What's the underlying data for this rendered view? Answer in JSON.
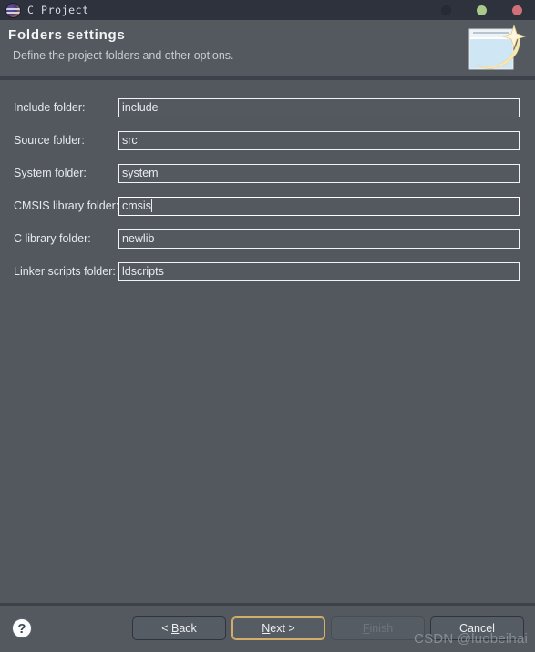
{
  "window": {
    "title": "C Project",
    "app_icon": "eclipse-c-project-icon",
    "controls": {
      "minimize": "minimize-dot",
      "maximize": "maximize-dot",
      "close": "close-dot"
    },
    "colors": {
      "titlebar_bg": "#2e323c",
      "dialog_bg": "#52585e",
      "separator": "#3c414a",
      "text": "#e6e9ed",
      "focus_ring": "#d3ad6a",
      "maximize_dot": "#a9c98c",
      "close_dot": "#d2707a",
      "minimize_dot": "#262a33"
    }
  },
  "header": {
    "title": "Folders settings",
    "subtitle": "Define the project folders and other options.",
    "banner_icon": "wizard-banner-icon"
  },
  "form": {
    "fields": [
      {
        "label": "Include folder:",
        "value": "include",
        "name": "include-folder",
        "focused": false
      },
      {
        "label": "Source folder:",
        "value": "src",
        "name": "source-folder",
        "focused": false
      },
      {
        "label": "System folder:",
        "value": "system",
        "name": "system-folder",
        "focused": false
      },
      {
        "label": "CMSIS library folder:",
        "value": "cmsis",
        "name": "cmsis-library-folder",
        "focused": true
      },
      {
        "label": "C library folder:",
        "value": "newlib",
        "name": "c-library-folder",
        "focused": false
      },
      {
        "label": "Linker scripts folder:",
        "value": "ldscripts",
        "name": "linker-scripts-folder",
        "focused": false
      }
    ]
  },
  "footer": {
    "help_glyph": "?",
    "buttons": [
      {
        "label": "< Back",
        "mnemonic": "B",
        "pre": "< ",
        "post": "ack",
        "state": "normal"
      },
      {
        "label": "Next >",
        "mnemonic": "N",
        "pre": "",
        "post": "ext >",
        "state": "focused"
      },
      {
        "label": "Finish",
        "mnemonic": "F",
        "pre": "",
        "post": "inish",
        "state": "disabled"
      },
      {
        "label": "Cancel",
        "mnemonic": "",
        "pre": "Cancel",
        "post": "",
        "state": "normal"
      }
    ],
    "watermark": "CSDN @luobeihai"
  }
}
